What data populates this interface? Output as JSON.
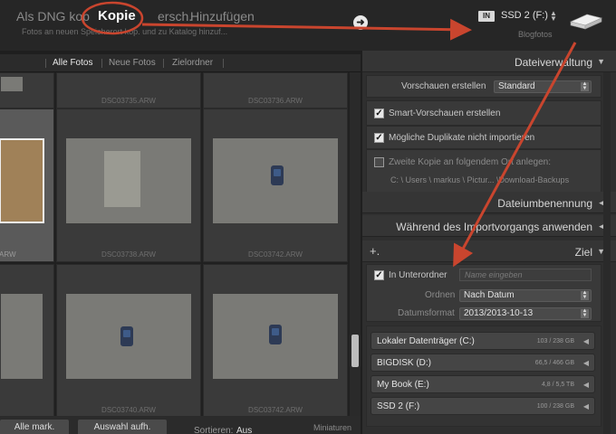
{
  "modes": {
    "dng": "Als DNG kop",
    "copy": "Kopie",
    "move": "ersch.",
    "add": "Hinzufügen",
    "description": "Fotos an neuen Speicherort kop. und zu Katalog hinzuf..."
  },
  "destination": {
    "badge": "IN",
    "name": "SSD 2 (F:)",
    "sub": "Blogfotos"
  },
  "filters": {
    "all": "Alle Fotos",
    "new": "Neue Fotos",
    "folders": "Zielordner"
  },
  "grid": {
    "row1": [
      "DSC03735.ARW",
      "DSC03736.ARW"
    ],
    "row2": [
      "ARW",
      "DSC03738.ARW",
      "DSC03742.ARW"
    ],
    "row3": [
      "DSC03740.ARW",
      "DSC03742.ARW"
    ]
  },
  "bottom": {
    "mark_all": "Alle mark.",
    "unmark": "Auswahl aufh.",
    "sort_label": "Sortieren:",
    "sort_value": "Aus",
    "thumbs_label": "Miniaturen"
  },
  "panel": {
    "file_handling": {
      "title": "Dateiverwaltung",
      "preview_label": "Vorschauen erstellen",
      "preview_value": "Standard",
      "smart_previews": "Smart-Vorschauen erstellen",
      "smart_previews_checked": true,
      "no_duplicates": "Mögliche Duplikate nicht importieren",
      "no_duplicates_checked": true,
      "second_copy": "Zweite Kopie an folgendem Ort anlegen:",
      "second_copy_checked": false,
      "second_copy_path": "C: \\ Users \\ markus \\ Pictur... \\Download-Backups"
    },
    "rename": {
      "title": "Dateiumbenennung"
    },
    "apply": {
      "title": "Während des Importvorgangs anwenden"
    },
    "destination": {
      "title": "Ziel",
      "add_icon": "+.",
      "subfolder_label": "In Unterordner",
      "subfolder_checked": true,
      "subfolder_placeholder": "Name eingeben",
      "organize_label": "Ordnen",
      "organize_value": "Nach Datum",
      "date_format_label": "Datumsformat",
      "date_format_value": "2013/2013-10-13",
      "volumes": [
        {
          "name": "Lokaler Datenträger (C:)",
          "size": "103 / 238 GB"
        },
        {
          "name": "BIGDISK (D:)",
          "size": "66,5 / 466 GB"
        },
        {
          "name": "My Book (E:)",
          "size": "4,8 / 5,5 TB"
        },
        {
          "name": "SSD 2 (F:)",
          "size": "100 / 238 GB"
        }
      ]
    }
  },
  "colors": {
    "annotation": "#c9452e",
    "accent_bg": "#1f1f1f"
  },
  "icons": [
    "arrow-right-icon",
    "drive-icon",
    "checkbox-icon",
    "triangle-icon",
    "plus-icon"
  ]
}
